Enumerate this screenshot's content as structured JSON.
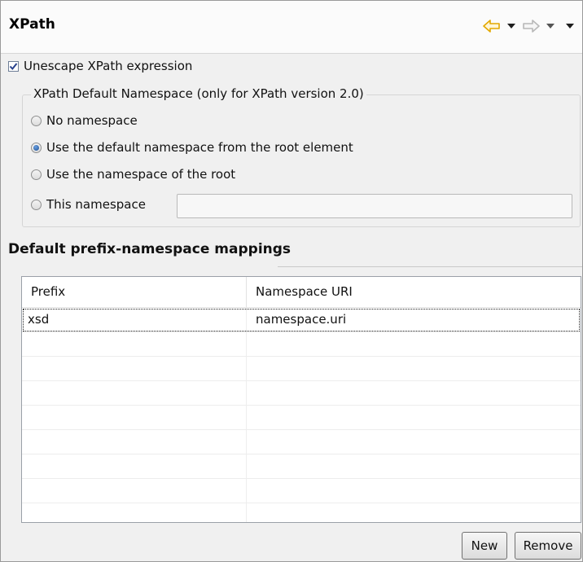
{
  "header": {
    "title": "XPath"
  },
  "options": {
    "unescape_checkbox": {
      "label": "Unescape XPath expression",
      "checked": true
    }
  },
  "namespace_group": {
    "legend": "XPath Default Namespace (only for XPath version 2.0)",
    "radios": [
      {
        "label": "No namespace",
        "selected": false
      },
      {
        "label": "Use the default namespace from the root element",
        "selected": true
      },
      {
        "label": "Use the namespace of the root",
        "selected": false
      },
      {
        "label": "This namespace",
        "selected": false
      }
    ],
    "namespace_value": ""
  },
  "mappings": {
    "title": "Default prefix-namespace mappings",
    "columns": [
      "Prefix",
      "Namespace URI"
    ],
    "rows": [
      {
        "prefix": "xsd",
        "uri": "namespace.uri"
      }
    ]
  },
  "buttons": {
    "new": "New",
    "remove": "Remove"
  },
  "colors": {
    "nav_back_arrow": "#f0b400",
    "nav_forward_arrow": "#b8b8b8",
    "radio_selected": "#1c4e94"
  }
}
